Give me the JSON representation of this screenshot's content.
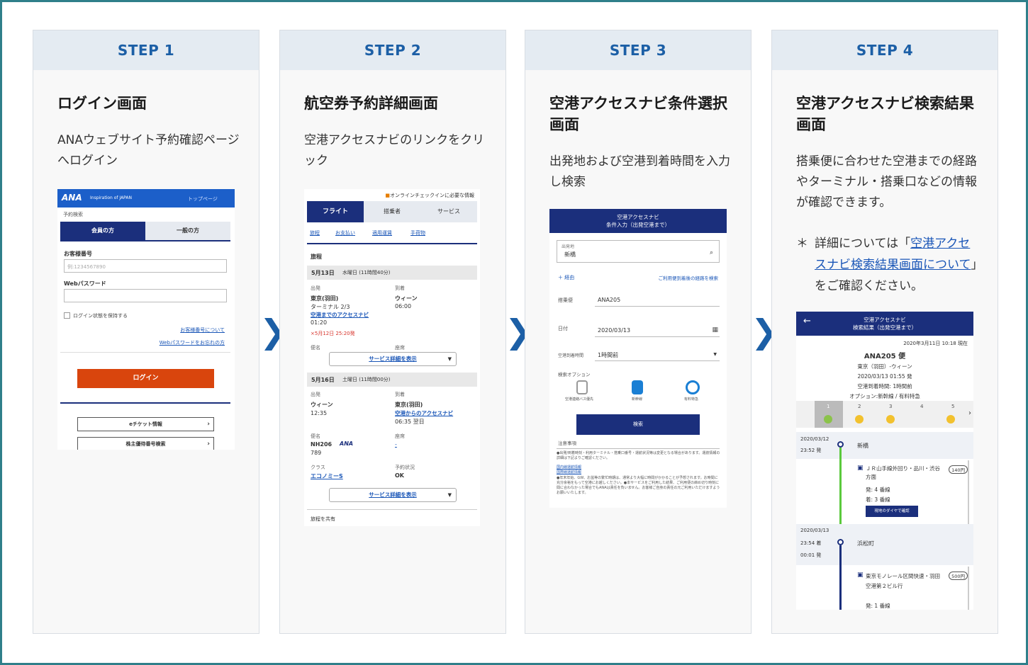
{
  "steps": [
    {
      "label": "STEP 1",
      "title": "ログイン画面",
      "desc": "ANAウェブサイト予約確認ページへログイン"
    },
    {
      "label": "STEP 2",
      "title": "航空券予約詳細画面",
      "desc": "空港アクセスナビのリンクをクリック"
    },
    {
      "label": "STEP 3",
      "title": "空港アクセスナビ条件選択画面",
      "desc": "出発地および空港到着時間を入力し検索"
    },
    {
      "label": "STEP 4",
      "title": "空港アクセスナビ検索結果画面",
      "desc": "搭乗便に合わせた空港までの経路やターミナル・搭乗口などの情報が確認できます。"
    }
  ],
  "note": {
    "star": "＊",
    "prefix": "詳細については「",
    "link": "空港アクセスナビ検索結果画面について",
    "suffix": "」をご確認ください。"
  },
  "arrow": "❯",
  "s1": {
    "logo": "ANA",
    "tagline": "Inspiration of JAPAN",
    "top": "トップページ",
    "crumb": "予約検索",
    "tab_member": "会員の方",
    "tab_general": "一般の方",
    "cust_label": "お客様番号",
    "cust_ph": "例:1234567890",
    "pw_label": "Webパスワード",
    "keep": "ログイン状態を保持する",
    "link1": "お客様番号について",
    "link2": "Webパスワードをお忘れの方",
    "login": "ログイン",
    "eticket": "eチケット情報",
    "kabu": "株主優待番号検索"
  },
  "s2": {
    "checkin": "オンラインチェックインに必要な情報",
    "tabs": [
      "フライト",
      "搭乗者",
      "サービス"
    ],
    "links": [
      "旅程",
      "お支払い",
      "適用運賃",
      "手荷物"
    ],
    "itinerary": "旅程",
    "seg1": {
      "date": "5月13日",
      "day": "水曜日 (11時間40分)",
      "dep_h": "出発",
      "arr_h": "到着",
      "dep": "東京(羽田)",
      "terminal": "ターミナル 2/3",
      "access": "空港までのアクセスナビ",
      "dep_time": "01:20",
      "arr": "ウィーン",
      "arr_time": "06:00",
      "warn": "×5月12日 25:20発",
      "col1": "便名",
      "col2": "座席",
      "svc": "サービス詳細を表示"
    },
    "seg2": {
      "date": "5月16日",
      "day": "土曜日 (11時間00分)",
      "dep_h": "出発",
      "arr_h": "到着",
      "dep": "ウィーン",
      "dep_time": "12:35",
      "arr": "東京(羽田)",
      "access": "空港からのアクセスナビ",
      "arr_time": "06:35 翌日",
      "flt_h": "便名",
      "flt": "NH206",
      "flt_no": "789",
      "seat_h": "座席",
      "seat": "-",
      "cls_h": "クラス",
      "cls": "エコノミーS",
      "stat_h": "予約状況",
      "stat": "OK",
      "svc": "サービス詳細を表示"
    },
    "share": "旅程を共有"
  },
  "s3": {
    "hdr1": "空港アクセスナビ",
    "hdr2": "条件入力（出発空港まで）",
    "from_label": "出発地",
    "from": "新橋",
    "via": "経由",
    "recent": "ご利用便到着後の経路を検索",
    "flt_label": "搭乗便",
    "flt": "ANA205",
    "date_label": "日付",
    "date": "2020/03/13",
    "arr_label": "空港到着時間",
    "arr": "1時間前",
    "opt_label": "検索オプション",
    "opts": [
      "空港連絡バス優先",
      "新幹線",
      "有料特急"
    ],
    "search": "検索",
    "notes_h": "注意事項",
    "notes": "●出発/到着時刻・利用ターミナル・搭乗口番号・運航状況等は変更となる場合があります。運航情報の詳細は下記よりご確認ください。",
    "link_a": "国内線運航情報",
    "link_b": "国際線運航情報",
    "notes2": "●年末年始、GW、お盆等の繁忙時期は、通常より大幅に時間がかかることが予想されます。お時間に充分余裕をもって空港にお越しください。●本サービスをご利用した結果、ご利用便の締め切り時刻に間に合わなかった場合でもANAは責任を負いません。お客様ご自身の責任の元ご利用いただけますようお願いいたします。"
  },
  "s4": {
    "hdr1": "空港アクセスナビ",
    "hdr2": "検索結果（出発空港まで）",
    "now": "2020年3月11日 10:18 現在",
    "flt": "ANA205 便",
    "route": "東京（羽田）-ウィーン",
    "dep": "2020/03/13 01:55 発",
    "arr": "空港到着時間: 1時間前",
    "opt": "オプション:新幹線 / 有料特急",
    "tabs": [
      "1",
      "2",
      "3",
      "4",
      "5"
    ],
    "t1_date": "2020/03/12",
    "t1_time": "23:52 発",
    "t1_st": "新橋",
    "leg1": "ＪＲ山手線外回り・品川・渋谷方面",
    "leg1_fare": "140円",
    "leg1_dep": "発: 4 番線",
    "leg1_arr": "着: 3 番線",
    "leg1_btn": "現地のダイヤで確認",
    "t2_date": "2020/03/13",
    "t2_time": "23:54 着",
    "t2_time2": "00:01 発",
    "t2_st": "浜松町",
    "leg2": "東京モノレール区間快速・羽田空港第２ビル行",
    "leg2_fare": "500円",
    "leg2_dep": "発: 1 番線"
  }
}
